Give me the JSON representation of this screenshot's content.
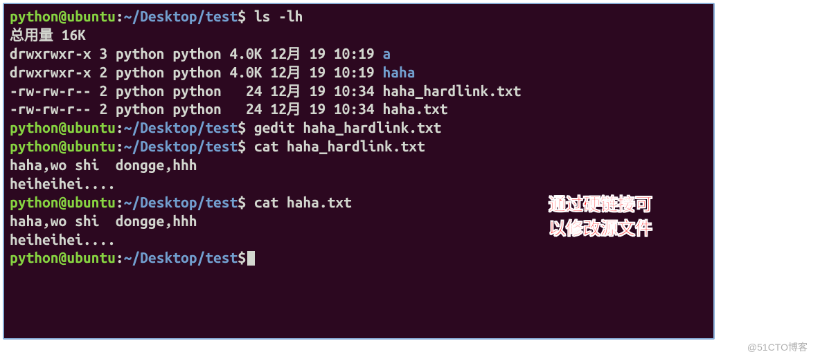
{
  "prompt": {
    "user_host": "python@ubuntu",
    "colon": ":",
    "path": "~/Desktop/test",
    "dollar": "$"
  },
  "lines": {
    "cmd1": " ls -lh",
    "total": "总用量 16K",
    "entry1_perms": "drwxrwxr-x 3 python python 4.0K 12月 19 10:19 ",
    "entry1_name": "a",
    "entry2_perms": "drwxrwxr-x 2 python python 4.0K 12月 19 10:19 ",
    "entry2_name": "haha",
    "entry3": "-rw-rw-r-- 2 python python   24 12月 19 10:34 haha_hardlink.txt",
    "entry4": "-rw-rw-r-- 2 python python   24 12月 19 10:34 haha.txt",
    "cmd2": " gedit haha_hardlink.txt",
    "cmd3": " cat haha_hardlink.txt",
    "out1": "haha,wo shi  dongge,hhh",
    "blank": "",
    "out2": "heiheihei....",
    "cmd4": " cat haha.txt",
    "out3": "haha,wo shi  dongge,hhh",
    "out4": "heiheihei...."
  },
  "annotation": {
    "line1": "通过硬链接可",
    "line2": "以修改源文件"
  },
  "watermark": "@51CTO博客"
}
